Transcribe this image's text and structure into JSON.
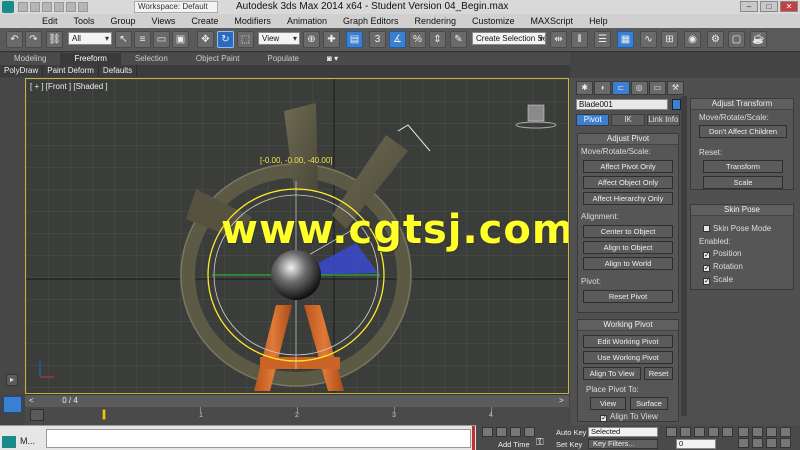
{
  "titlebar": {
    "workspace": "Workspace: Default",
    "title": "Autodesk 3ds Max  2014 x64   - Student Version    04_Begin.max",
    "minimize": "–",
    "maximize": "□",
    "close": "✕"
  },
  "menu": [
    "Edit",
    "Tools",
    "Group",
    "Views",
    "Create",
    "Modifiers",
    "Animation",
    "Graph Editors",
    "Rendering",
    "Customize",
    "MAXScript",
    "Help"
  ],
  "toolbar": {
    "selection_filter": "All",
    "reference_coord": "View",
    "named_selection": "Create Selection Se"
  },
  "ribbon": {
    "tabs": [
      "Modeling",
      "Freeform",
      "Selection",
      "Object Paint",
      "Populate"
    ],
    "active_tab": "Freeform",
    "pin": "◙ ▾",
    "subtabs": [
      "PolyDraw",
      "Paint Deform",
      "Defaults"
    ]
  },
  "viewport": {
    "label": "[ + ] [Front ] [Shaded ]",
    "coord_readout": "[-0.00, -0.00, -40.00]",
    "watermark": "www.cgtsj.com"
  },
  "command_panel": {
    "object_name": "Blade001",
    "hierarchy_tabs": [
      "Pivot",
      "IK",
      "Link Info"
    ],
    "active_hierarchy_tab": "Pivot",
    "adjust_pivot": {
      "title": "Adjust Pivot",
      "move_label": "Move/Rotate/Scale:",
      "buttons": [
        "Affect Pivot Only",
        "Affect Object Only",
        "Affect Hierarchy Only"
      ],
      "alignment_label": "Alignment:",
      "align_buttons": [
        "Center to Object",
        "Align to Object",
        "Align to World"
      ],
      "pivot_label": "Pivot:",
      "reset_pivot": "Reset Pivot"
    },
    "working_pivot": {
      "title": "Working Pivot",
      "buttons": [
        "Edit Working Pivot",
        "Use Working Pivot"
      ],
      "align_to_view": "Align To View",
      "reset": "Reset",
      "place_label": "Place Pivot To:",
      "view": "View",
      "surface": "Surface",
      "align_check": "Align To View"
    },
    "adjust_transform": {
      "title": "Adjust Transform",
      "move_label": "Move/Rotate/Scale:",
      "dont_affect": "Don't Affect Children",
      "reset_label": "Reset:",
      "transform": "Transform",
      "scale": "Scale"
    },
    "skin_pose": {
      "title": "Skin Pose",
      "mode": "Skin Pose Mode",
      "enabled_label": "Enabled:",
      "checks": [
        "Position",
        "Rotation",
        "Scale"
      ]
    }
  },
  "timeline": {
    "frame": "0 / 4",
    "prev": "<",
    "next": ">",
    "ticks": [
      "1",
      "2",
      "3",
      "4"
    ]
  },
  "status": {
    "task_label": "M...",
    "auto_key": "Auto Key",
    "set_key": "Set Key",
    "selected": "Selected",
    "key_filters": "Key Filters...",
    "add_time": "Add Time",
    "frame_field": "0"
  }
}
